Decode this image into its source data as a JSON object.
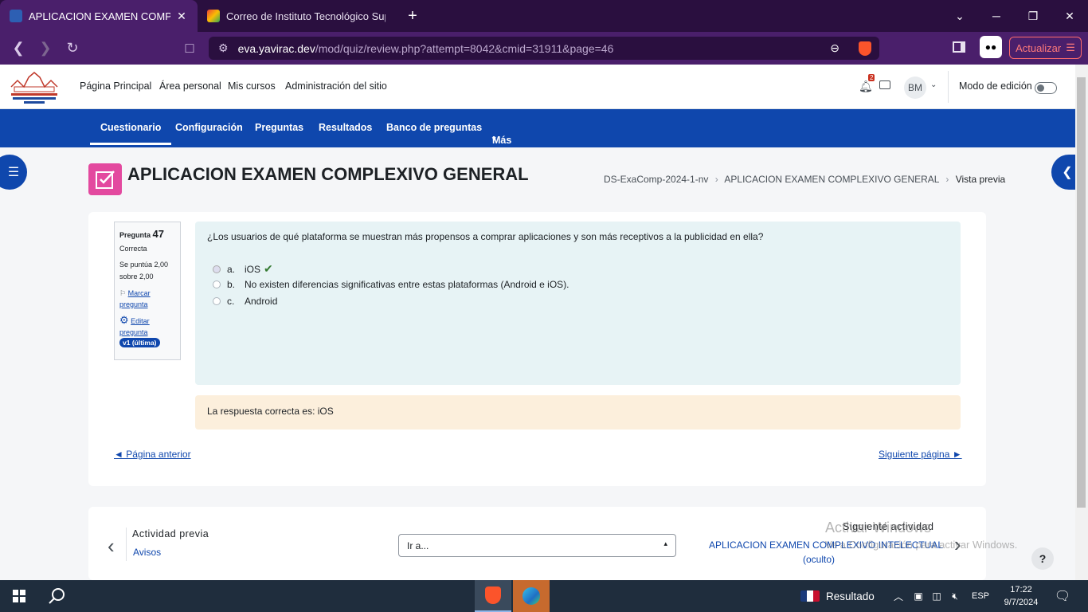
{
  "browser": {
    "tabs": [
      {
        "title": "APLICACION EXAMEN COMPLEXIVO",
        "active": true
      },
      {
        "title": "Correo de Instituto Tecnológico Superior",
        "active": false
      }
    ],
    "url_domain": "eva.yavirac.dev",
    "url_path": "/mod/quiz/review.php?attempt=8042&cmid=31911&page=46",
    "update_label": "Actualizar"
  },
  "topnav": {
    "items": [
      "Página Principal",
      "Área personal",
      "Mis cursos",
      "Administración del sitio"
    ],
    "notif_count": "2",
    "avatar": "BM",
    "edit_mode_label": "Modo de edición"
  },
  "secnav": {
    "items": [
      "Cuestionario",
      "Configuración",
      "Preguntas",
      "Resultados",
      "Banco de preguntas",
      "Más"
    ]
  },
  "page": {
    "title": "APLICACION EXAMEN COMPLEXIVO GENERAL",
    "breadcrumb": [
      "DS-ExaComp-2024-1-nv",
      "APLICACION EXAMEN COMPLEXIVO GENERAL",
      "Vista previa"
    ]
  },
  "question": {
    "label": "Pregunta",
    "number": "47",
    "state": "Correcta",
    "grade_line1": "Se puntúa 2,00",
    "grade_line2": "sobre 2,00",
    "flag_line1": "Marcar",
    "flag_line2": "pregunta",
    "edit_line1": "Editar",
    "edit_line2": "pregunta",
    "version": "v1 (última)",
    "text": "¿Los usuarios de qué plataforma se muestran más propensos a comprar aplicaciones y son más receptivos a la publicidad en ella?",
    "options": [
      {
        "letter": "a.",
        "text": "iOS",
        "selected": true,
        "correct": true
      },
      {
        "letter": "b.",
        "text": "No existen diferencias significativas entre estas plataformas (Android e iOS).",
        "selected": false
      },
      {
        "letter": "c.",
        "text": "Android",
        "selected": false
      }
    ],
    "feedback": "La respuesta correcta es: iOS"
  },
  "pager": {
    "prev": "◄ Página anterior",
    "next": "Siguiente página ►"
  },
  "activity_nav": {
    "prev_label": "Actividad previa",
    "prev_name": "Avisos",
    "jump_placeholder": "Ir a...",
    "next_label": "Siguiente actividad",
    "next_name": "APLICACION EXAMEN COMPLEXIVO INTELECTUAL",
    "next_note": "(oculto)"
  },
  "watermark": {
    "line1": "Activar Windows",
    "line2": "Ve a Configuración para activar Windows."
  },
  "taskbar": {
    "result_label": "Resultado",
    "lang": "ESP",
    "time": "17:22",
    "date": "9/7/2024"
  },
  "colors": {
    "brand_blue": "#0f47ad",
    "quiz_pink": "#e3499f",
    "browser_purple": "#4a1f6b"
  }
}
